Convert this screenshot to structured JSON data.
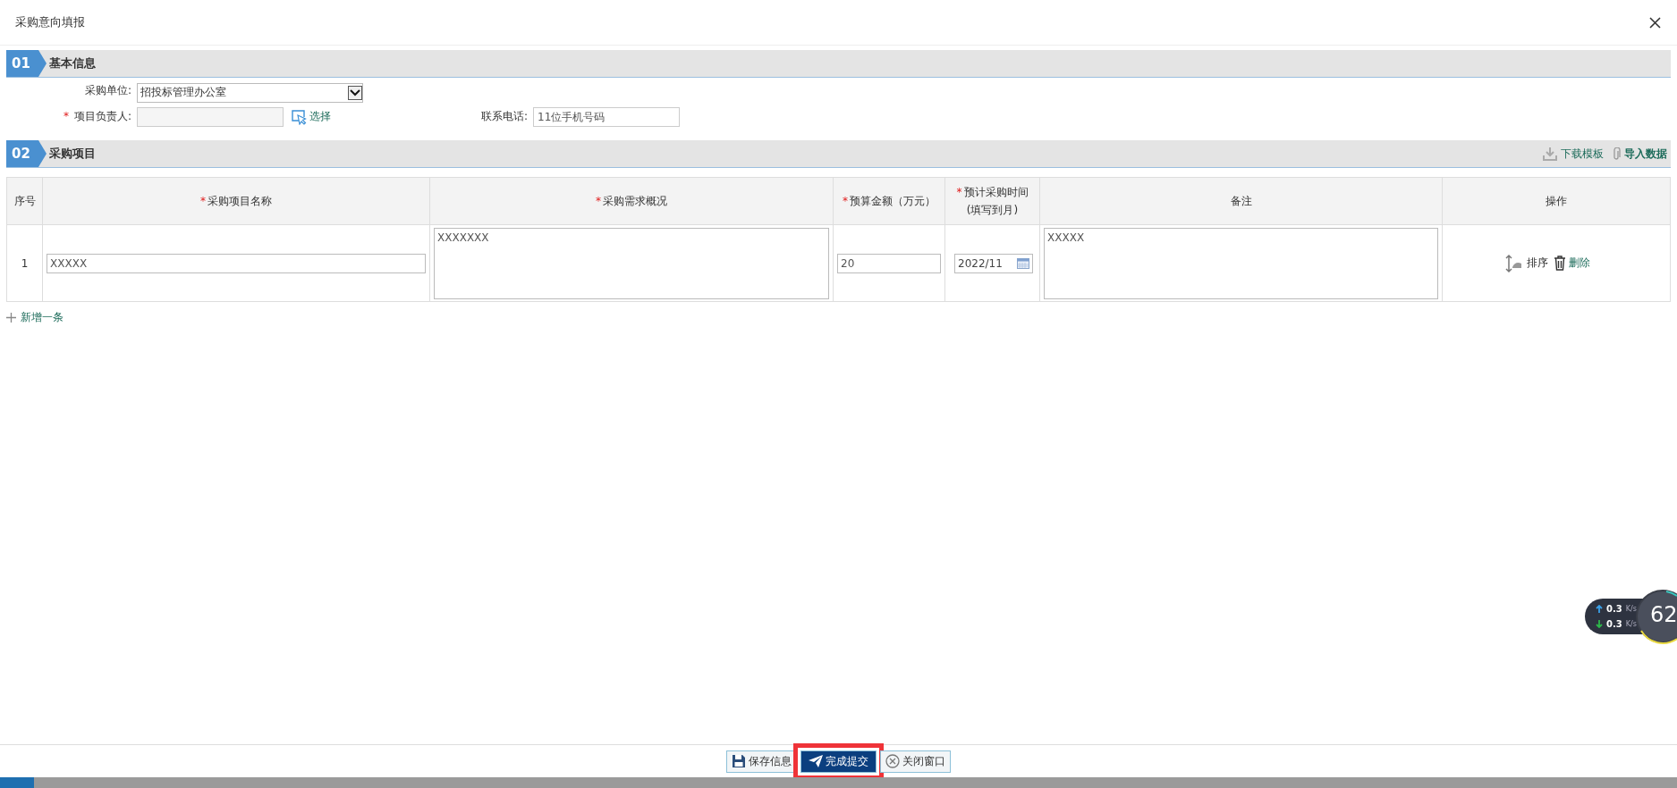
{
  "title": "采购意向填报",
  "basic_section": {
    "number": "01",
    "title": "基本信息",
    "unit": {
      "label": "采购单位:",
      "value": "招投标管理办公室"
    },
    "manager": {
      "label": "项目负责人:",
      "required_mark": "*",
      "action": "选择"
    },
    "phone": {
      "label": "联系电话:",
      "placeholder": "11位手机号码"
    }
  },
  "items_section": {
    "number": "02",
    "title": "采购项目",
    "tools": [
      {
        "kind": "download",
        "label": "下载模板"
      },
      {
        "kind": "import",
        "label": "导入数据"
      }
    ],
    "table": {
      "columns": [
        {
          "label": "序号"
        },
        {
          "label": "采购项目名称",
          "required_mark": "*"
        },
        {
          "label": "采购需求概况",
          "required_mark": "*"
        },
        {
          "label": "预算金额（万元）",
          "required_mark": "*"
        },
        {
          "label": "预计采购时间",
          "sub": "(填写到月)",
          "required_mark": "*"
        },
        {
          "label": "备注"
        },
        {
          "label": "操作"
        }
      ],
      "rows": [
        {
          "index": "1",
          "name": "XXXXX",
          "summary": "XXXXXXX",
          "budget": "20",
          "date": "2022/11",
          "remark": "XXXXX",
          "actions": [
            {
              "kind": "sort",
              "label": "排序"
            },
            {
              "kind": "delete",
              "label": "删除"
            }
          ]
        }
      ]
    },
    "add_label": "新增一条"
  },
  "footer_buttons": [
    {
      "kind": "save",
      "label": "保存信息",
      "primary": false,
      "highlighted": false
    },
    {
      "kind": "submit",
      "label": "完成提交",
      "primary": true,
      "highlighted": true
    },
    {
      "kind": "close",
      "label": "关闭窗口",
      "primary": false,
      "highlighted": false
    }
  ],
  "speed_widget": {
    "upload": "0.3",
    "upload_unit": "K/s",
    "download": "0.3",
    "download_unit": "K/s",
    "percent": "62"
  }
}
